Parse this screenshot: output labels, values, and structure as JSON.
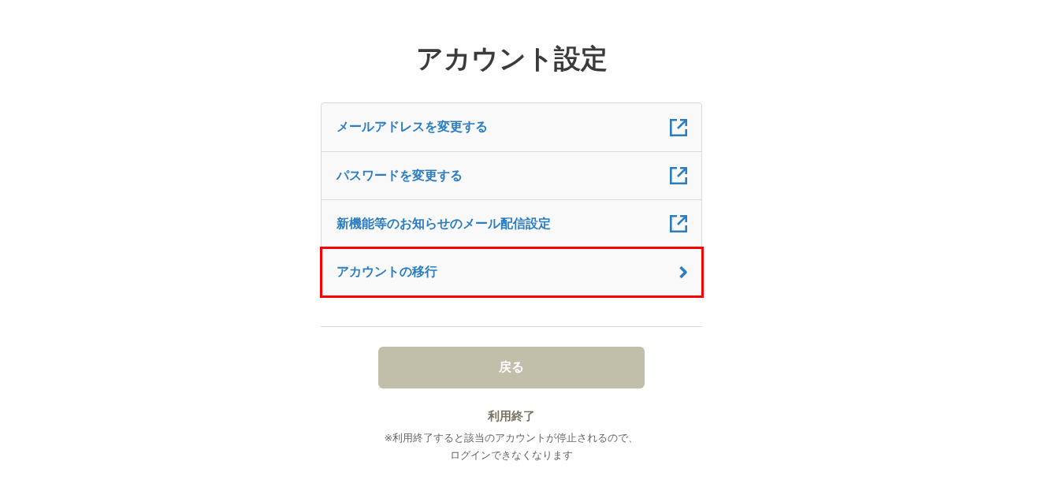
{
  "page": {
    "title": "アカウント設定"
  },
  "menu": {
    "items": [
      {
        "label": "メールアドレスを変更する",
        "kind": "external",
        "highlighted": false
      },
      {
        "label": "パスワードを変更する",
        "kind": "external",
        "highlighted": false
      },
      {
        "label": "新機能等のお知らせのメール配信設定",
        "kind": "external",
        "highlighted": false
      },
      {
        "label": "アカウントの移行",
        "kind": "chevron",
        "highlighted": true
      }
    ]
  },
  "back_button": {
    "label": "戻る"
  },
  "terminate": {
    "label": "利用終了",
    "notice": [
      "※利用終了すると該当のアカウントが停止されるので、",
      "ログインできなくなります"
    ]
  }
}
